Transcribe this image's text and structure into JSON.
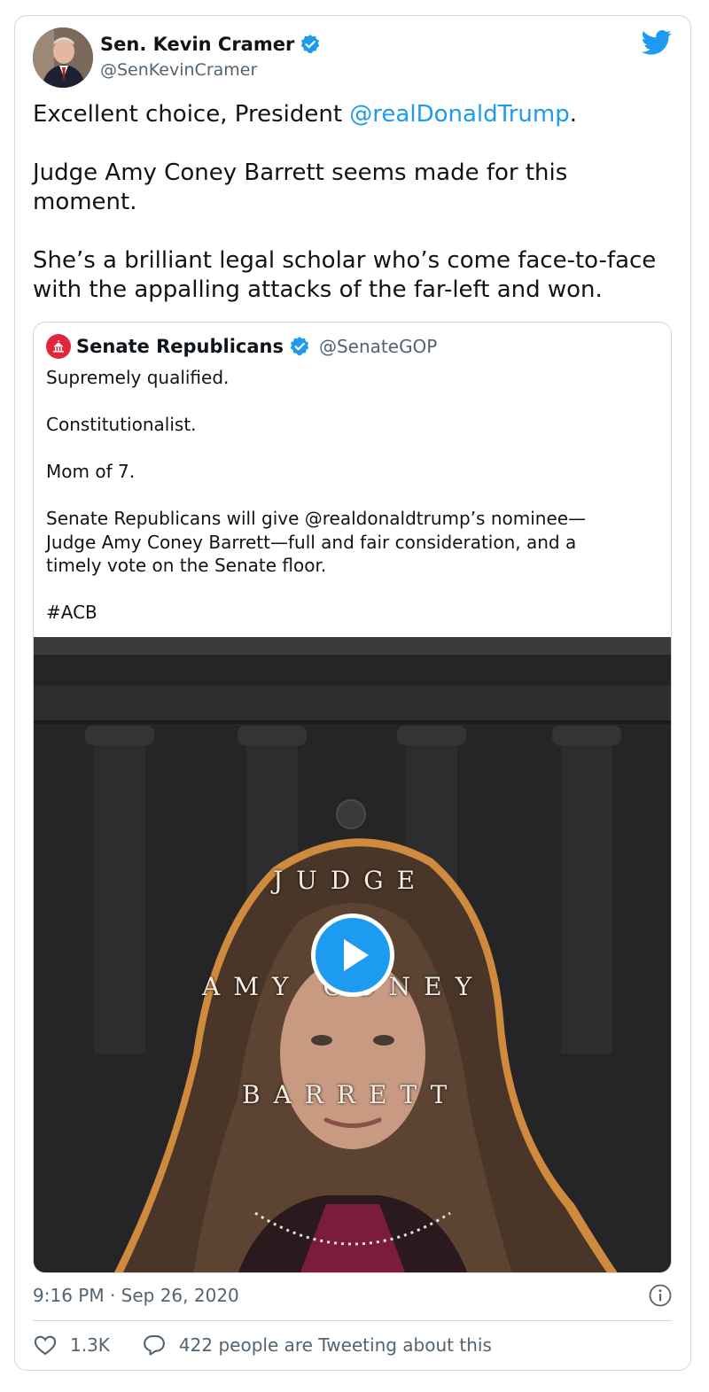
{
  "author": {
    "name": "Sen. Kevin Cramer",
    "handle": "@SenKevinCramer"
  },
  "tweet": {
    "line1_before": "Excellent choice, President ",
    "line1_mention": "@realDonaldTrump",
    "line1_after": ".",
    "para2": "Judge Amy Coney Barrett seems made for this\nmoment.",
    "para3": "She’s a brilliant legal scholar who’s come face-to-face\nwith the appalling attacks of the far-left and won."
  },
  "quoted": {
    "name": "Senate Republicans",
    "handle": "@SenateGOP",
    "text": "Supremely qualified.\n\nConstitutionalist.\n\nMom of 7.\n\nSenate Republicans will give @realdonaldtrump’s nominee—\nJudge Amy Coney Barrett—full and fair consideration, and a\ntimely vote on the Senate floor.\n\n#ACB",
    "video_overlay": {
      "word1": "JUDGE",
      "word2": "AMY CONEY",
      "word3": "BARRETT"
    }
  },
  "meta": {
    "timestamp": "9:16 PM · Sep 26, 2020"
  },
  "actions": {
    "likes": "1.3K",
    "replies_text": "422 people are Tweeting about this"
  },
  "colors": {
    "accent": "#1d9bf0",
    "text": "#0f1419",
    "secondary": "#536471",
    "border": "#cfd9de",
    "gop_red": "#e0263a"
  },
  "icons": [
    "verified-badge-icon",
    "twitter-bird-icon",
    "play-icon",
    "info-icon",
    "heart-icon",
    "reply-bubble-icon",
    "capitol-icon"
  ]
}
